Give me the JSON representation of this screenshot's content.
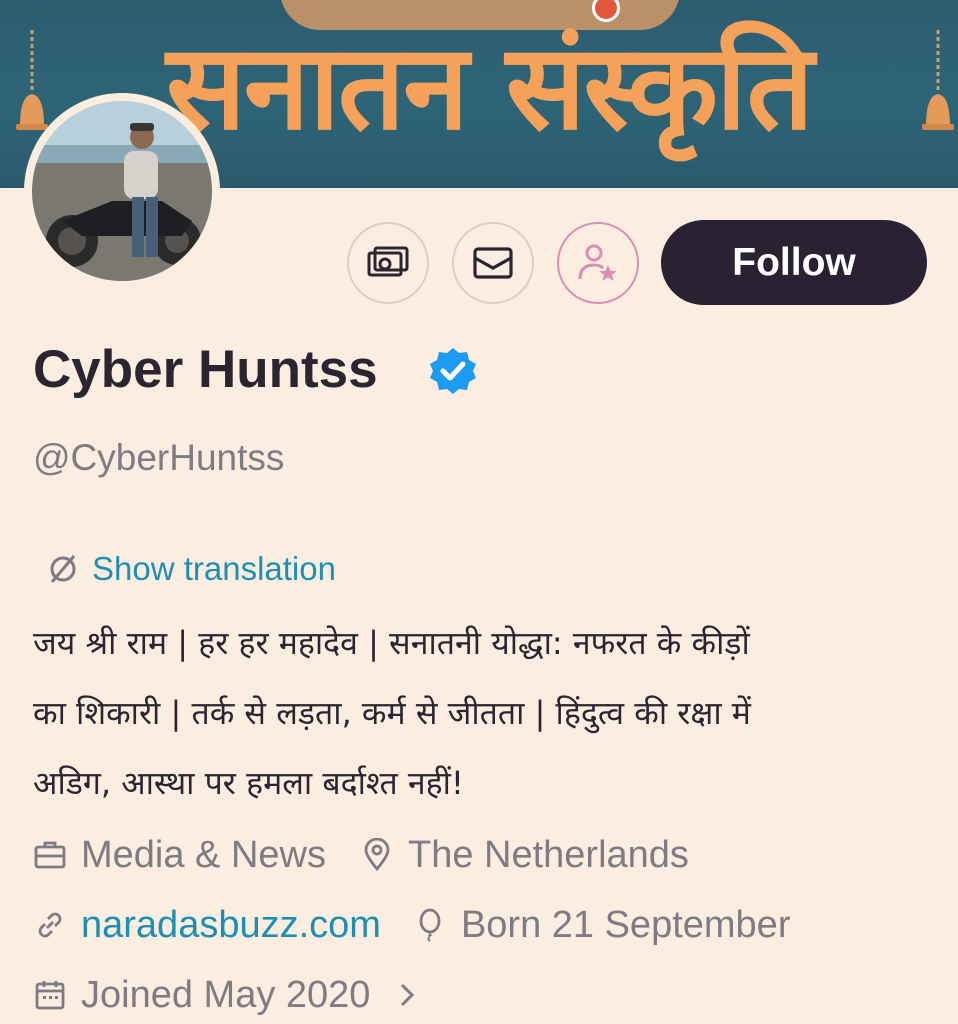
{
  "banner": {
    "title": "सनातन संस्कृति"
  },
  "profile": {
    "display_name": "Cyber Huntss",
    "handle": "@CyberHuntss",
    "follow_label": "Follow",
    "show_translation": "Show translation",
    "bio_line1": "जय श्री राम | हर हर महादेव | सनातनी योद्धा: नफरत के कीड़ों",
    "bio_line2": "का शिकारी | तर्क से लड़ता, कर्म से जीतता | हिंदुत्व की रक्षा में",
    "bio_line3": "अडिग, आस्था पर हमला बर्दाश्त नहीं!",
    "category": "Media & News",
    "location": "The Netherlands",
    "website": "naradasbuzz.com",
    "birthday": "Born 21 September",
    "joined": "Joined May 2020"
  },
  "colors": {
    "background": "#fbeee1",
    "follow_button": "#2a2133",
    "link": "#1d8fb2",
    "secondary_text": "#7f7b82",
    "verified": "#1d9bf0",
    "subscribe_accent": "#d98fb6",
    "banner_bg": "#2e6477",
    "banner_text": "#f5a15a"
  },
  "icons": [
    "tip-icon",
    "message-icon",
    "subscribe-icon",
    "verified-badge-icon",
    "translate-icon",
    "briefcase-icon",
    "location-pin-icon",
    "link-icon",
    "balloon-icon",
    "calendar-icon",
    "chevron-right-icon"
  ]
}
